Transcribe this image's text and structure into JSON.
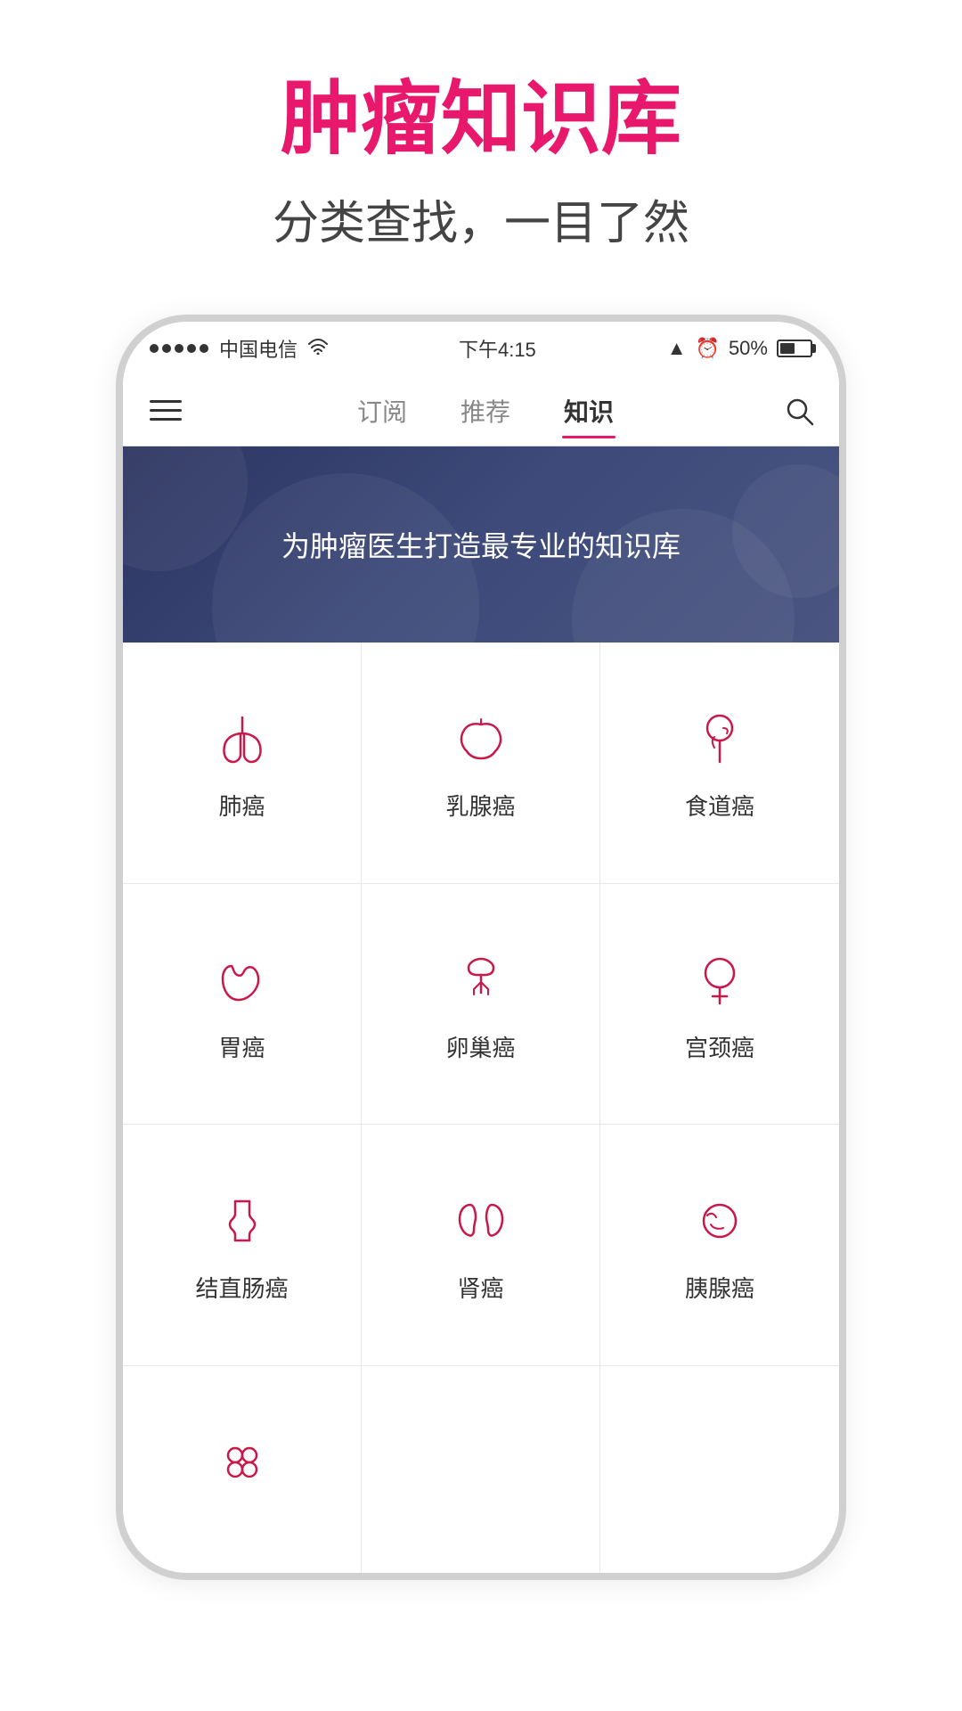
{
  "page": {
    "title_main": "肿瘤知识库",
    "title_sub": "分类查找，一目了然"
  },
  "status_bar": {
    "carrier": "中国电信",
    "wifi": "WiFi",
    "time": "下午4:15",
    "battery": "50%"
  },
  "nav": {
    "tab1": "订阅",
    "tab2": "推荐",
    "tab3": "知识"
  },
  "banner": {
    "text": "为肿瘤医生打造最专业的知识库"
  },
  "categories": [
    {
      "label": "肺癌",
      "icon": "lung"
    },
    {
      "label": "乳腺癌",
      "icon": "breast"
    },
    {
      "label": "食道癌",
      "icon": "throat"
    },
    {
      "label": "胃癌",
      "icon": "stomach"
    },
    {
      "label": "卵巢癌",
      "icon": "ovary"
    },
    {
      "label": "宫颈癌",
      "icon": "uterus"
    },
    {
      "label": "结直肠癌",
      "icon": "colon"
    },
    {
      "label": "肾癌",
      "icon": "kidney"
    },
    {
      "label": "胰腺癌",
      "icon": "pancreas"
    },
    {
      "label": "",
      "icon": "other"
    }
  ]
}
